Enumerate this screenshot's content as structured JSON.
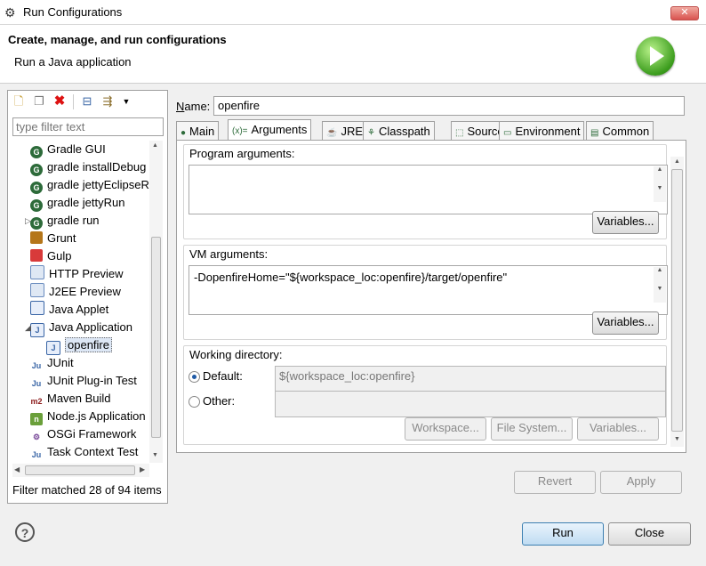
{
  "window": {
    "title": "Run Configurations",
    "close_glyph": "✕"
  },
  "header": {
    "title": "Create, manage, and run configurations",
    "subtitle": "Run a Java application"
  },
  "left": {
    "filter_placeholder": "type filter text",
    "tree": [
      {
        "label": "Gradle GUI",
        "icon": "gradle-icon",
        "level": 1
      },
      {
        "label": "gradle installDebug",
        "icon": "gradle-icon",
        "level": 1
      },
      {
        "label": "gradle jettyEclipseRun",
        "icon": "gradle-icon",
        "level": 1
      },
      {
        "label": "gradle jettyRun",
        "icon": "gradle-icon",
        "level": 1
      },
      {
        "label": "gradle run",
        "icon": "gradle-icon",
        "level": 1,
        "expander": "▷"
      },
      {
        "label": "Grunt",
        "icon": "grunt-icon",
        "level": 1
      },
      {
        "label": "Gulp",
        "icon": "gulp-icon",
        "level": 1
      },
      {
        "label": "HTTP Preview",
        "icon": "http-preview-icon",
        "level": 1
      },
      {
        "label": "J2EE Preview",
        "icon": "j2ee-preview-icon",
        "level": 1
      },
      {
        "label": "Java Applet",
        "icon": "java-applet-icon",
        "level": 1
      },
      {
        "label": "Java Application",
        "icon": "java-application-icon",
        "level": 1,
        "expander": "◢"
      },
      {
        "label": "openfire",
        "icon": "java-config-icon",
        "level": 2,
        "selected": true
      },
      {
        "label": "JUnit",
        "icon": "junit-icon",
        "level": 1
      },
      {
        "label": "JUnit Plug-in Test",
        "icon": "junit-plugin-icon",
        "level": 1
      },
      {
        "label": "Maven Build",
        "icon": "maven-icon",
        "level": 1
      },
      {
        "label": "Node.js Application",
        "icon": "nodejs-icon",
        "level": 1
      },
      {
        "label": "OSGi Framework",
        "icon": "osgi-icon",
        "level": 1
      },
      {
        "label": "Task Context Test",
        "icon": "task-context-icon",
        "level": 1
      }
    ],
    "status": "Filter matched 28 of 94 items"
  },
  "main": {
    "name_label": "Name:",
    "name_value": "openfire",
    "tabs": [
      {
        "label": "Main",
        "icon": "main-tab-icon"
      },
      {
        "label": "Arguments",
        "icon": "arguments-tab-icon",
        "active": true
      },
      {
        "label": "JRE",
        "icon": "jre-tab-icon"
      },
      {
        "label": "Classpath",
        "icon": "classpath-tab-icon"
      },
      {
        "label": "Source",
        "icon": "source-tab-icon"
      },
      {
        "label": "Environment",
        "icon": "environment-tab-icon"
      },
      {
        "label": "Common",
        "icon": "common-tab-icon"
      }
    ],
    "program_args_label": "Program arguments:",
    "program_args_value": "",
    "variables_label": "Variables...",
    "vm_args_label": "VM arguments:",
    "vm_args_value": "-DopenfireHome=\"${workspace_loc:openfire}/target/openfire\"",
    "working_dir_label": "Working directory:",
    "default_label": "Default:",
    "default_value": "${workspace_loc:openfire}",
    "other_label": "Other:",
    "other_value": "",
    "workspace_label": "Workspace...",
    "filesystem_label": "File System...",
    "revert_label": "Revert",
    "apply_label": "Apply"
  },
  "footer": {
    "run_label": "Run",
    "close_label": "Close",
    "help_glyph": "?"
  }
}
